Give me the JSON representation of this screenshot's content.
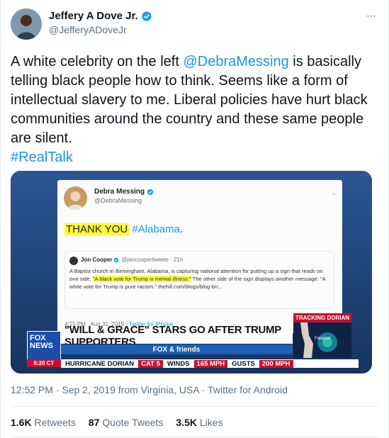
{
  "author": {
    "name": "Jeffery A Dove Jr.",
    "handle": "@JefferyADoveJr",
    "verified": true,
    "avatar_icon": "user-avatar"
  },
  "tweet": {
    "text_1": "A white celebrity on the left ",
    "mention": "@DebraMessing",
    "text_2": " is basically telling black people how to think. Seems like a form of intellectual slavery to me. Liberal policies have hurt black communities around the country and  these same people are silent.",
    "hashtag": "#RealTalk",
    "timestamp": "12:52 PM · Sep 2, 2019 from Virginia, USA · Twitter for Android"
  },
  "stats": {
    "retweets_count": "1.6K",
    "retweets_label": " Retweets",
    "quotes_count": "87",
    "quotes_label": " Quote Tweets",
    "likes_count": "3.5K",
    "likes_label": " Likes"
  },
  "media": {
    "embedded_tweet": {
      "name": "Debra Messing",
      "handle": "@DebraMessing",
      "highlight": "THANK YOU",
      "hashtag": "#Alabama",
      "period": ".",
      "quote": {
        "name": "Jon Cooper",
        "meta": "@joncoopertweets · 21h",
        "body_1": "A Baptist church in Birmingham, Alabama, is capturing national attention for putting up a sign that reads on one side, ",
        "body_highlight": "\"A black vote for Trump is mental illness.\"",
        "body_2": " The other side of the sign displays another message: \"A white vote for Trump is pure racism.\" thehill.com/blogs/blog-bri..."
      },
      "time": "4:15 PM · Aug 31, 2019 · ",
      "via": "Twitter for iPhone"
    },
    "broadcast": {
      "tracking_label": "TRACKING DORIAN",
      "map_label": "Freeport",
      "headline": "\"WILL & GRACE\" STARS GO AFTER TRUMP SUPPORTERS",
      "show": "FOX & friends",
      "logo_line1": "FOX",
      "logo_line2": "NEWS",
      "logo_time": "6:20 CT",
      "ticker": {
        "item1": "HURRICANE DORIAN",
        "item2": "CAT 5",
        "item3": "WINDS",
        "item4": "165 MPH",
        "item5": "GUSTS",
        "item6": "200 MPH"
      }
    }
  },
  "colors": {
    "link": "#1b95e0",
    "muted": "#5b7083",
    "verified": "#1da1f2",
    "highlight": "#fdf83a"
  }
}
